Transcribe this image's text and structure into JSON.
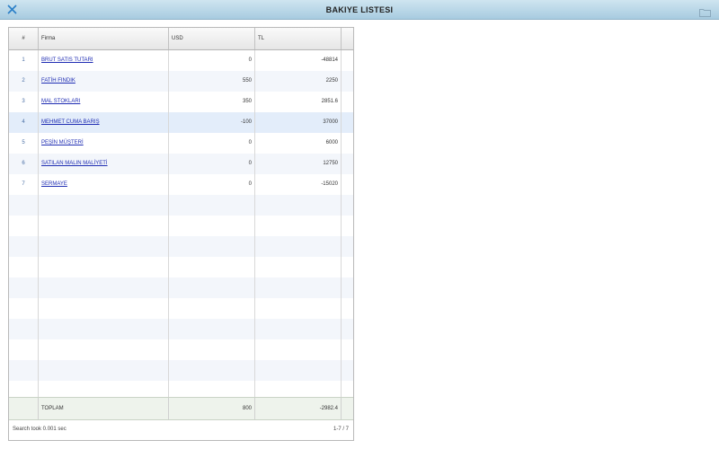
{
  "window": {
    "title": "BAKIYE LISTESI"
  },
  "table": {
    "columns": {
      "index": "#",
      "firma": "Firma",
      "usd": "USD",
      "tl": "TL"
    },
    "rows": [
      {
        "index": "1",
        "firma": "BRUT SATIS TUTARI",
        "usd": "0",
        "tl": "-48814"
      },
      {
        "index": "2",
        "firma": "FATİH FINDIK",
        "usd": "550",
        "tl": "2250"
      },
      {
        "index": "3",
        "firma": "MAL STOKLARI",
        "usd": "350",
        "tl": "2851.6"
      },
      {
        "index": "4",
        "firma": "MEHMET CUMA BARIŞ",
        "usd": "-100",
        "tl": "37000"
      },
      {
        "index": "5",
        "firma": "PEŞİN MÜŞTERİ",
        "usd": "0",
        "tl": "6000"
      },
      {
        "index": "6",
        "firma": "SATILAN MALIN MALİYETİ",
        "usd": "0",
        "tl": "12750"
      },
      {
        "index": "7",
        "firma": "SERMAYE",
        "usd": "0",
        "tl": "-15020"
      }
    ],
    "footer": {
      "label": "TOPLAM",
      "usd": "800",
      "tl": "-2982.4"
    }
  },
  "status": {
    "search_time": "Search took 0.001 sec",
    "pagination": "1-7 / 7"
  },
  "colors": {
    "header_bar": "#a7cbe0",
    "link": "#1f2db3",
    "selected_row": "#e3edfa",
    "alt_row": "#f3f6fb",
    "footer": "#eef3ec"
  }
}
